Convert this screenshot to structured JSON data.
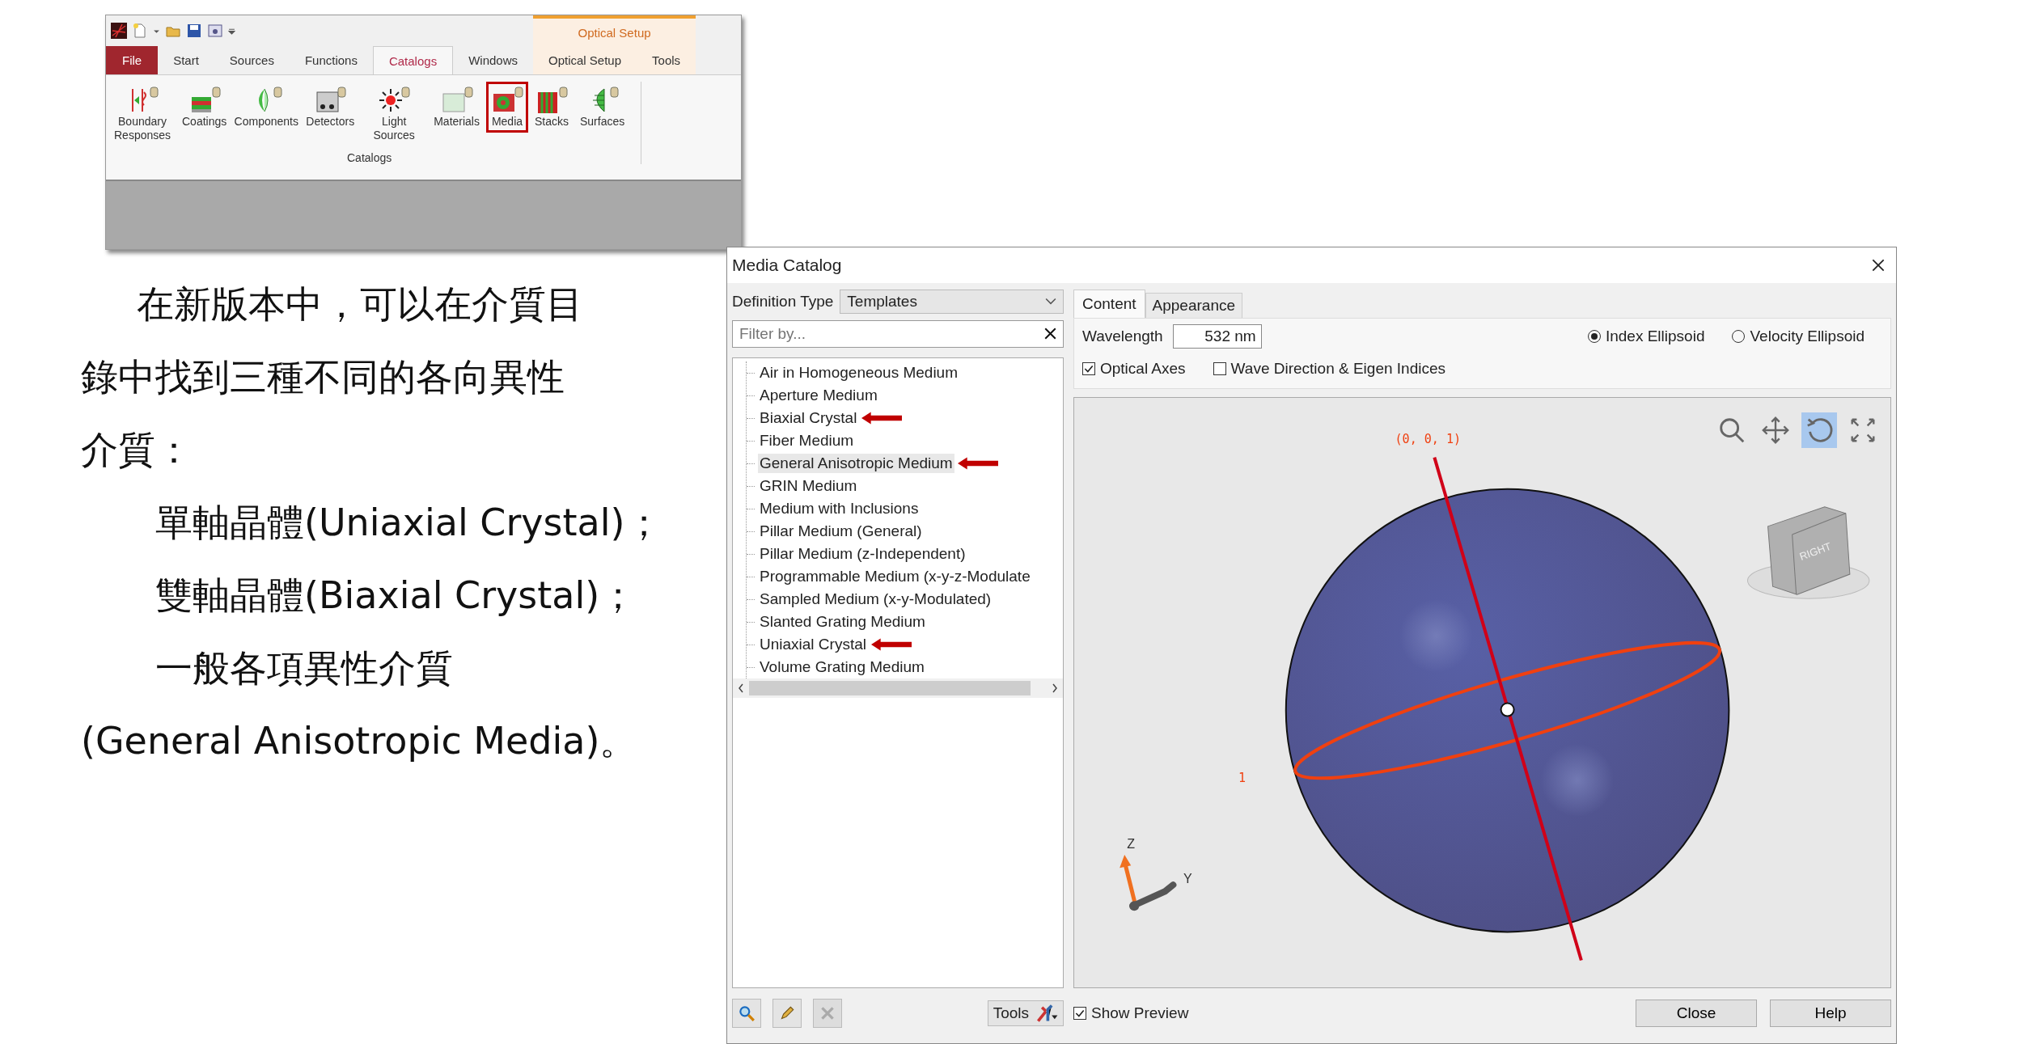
{
  "ribbon": {
    "tabs": [
      {
        "label": "File",
        "kind": "file",
        "selected": false,
        "contextual": false
      },
      {
        "label": "Start",
        "kind": "tab",
        "selected": false,
        "contextual": false
      },
      {
        "label": "Sources",
        "kind": "tab",
        "selected": false,
        "contextual": false
      },
      {
        "label": "Functions",
        "kind": "tab",
        "selected": false,
        "contextual": false
      },
      {
        "label": "Catalogs",
        "kind": "tab",
        "selected": true,
        "contextual": false
      },
      {
        "label": "Windows",
        "kind": "tab",
        "selected": false,
        "contextual": false
      },
      {
        "label": "Optical Setup",
        "kind": "tab",
        "selected": false,
        "contextual": true
      },
      {
        "label": "Tools",
        "kind": "tab",
        "selected": false,
        "contextual": true
      }
    ],
    "contextual_group": "Optical Setup",
    "buttons": [
      {
        "label": "Boundary Responses",
        "highlighted": false
      },
      {
        "label": "Coatings",
        "highlighted": false
      },
      {
        "label": "Components",
        "highlighted": false
      },
      {
        "label": "Detectors",
        "highlighted": false
      },
      {
        "label": "Light Sources",
        "highlighted": false
      },
      {
        "label": "Materials",
        "highlighted": false
      },
      {
        "label": "Media",
        "highlighted": true
      },
      {
        "label": "Stacks",
        "highlighted": false
      },
      {
        "label": "Surfaces",
        "highlighted": false
      }
    ],
    "group_label": "Catalogs"
  },
  "text": {
    "intro": "在新版本中，可以在介質目錄中找到三種不同的各向異性介質：",
    "items": [
      "單軸晶體(Uniaxial Crystal)；",
      "雙軸晶體(Biaxial Crystal)；",
      "一般各項異性介質\n(General Anisotropic Media)。"
    ]
  },
  "dialog": {
    "title": "Media Catalog",
    "definition_type": {
      "label": "Definition Type",
      "value": "Templates"
    },
    "filter": {
      "placeholder": "Filter by..."
    },
    "tree": [
      {
        "label": "Air in Homogeneous Medium",
        "selected": false,
        "marked": false
      },
      {
        "label": "Aperture Medium",
        "selected": false,
        "marked": false
      },
      {
        "label": "Biaxial Crystal",
        "selected": false,
        "marked": true
      },
      {
        "label": "Fiber Medium",
        "selected": false,
        "marked": false
      },
      {
        "label": "General Anisotropic Medium",
        "selected": true,
        "marked": true
      },
      {
        "label": "GRIN Medium",
        "selected": false,
        "marked": false
      },
      {
        "label": "Medium with Inclusions",
        "selected": false,
        "marked": false
      },
      {
        "label": "Pillar Medium (General)",
        "selected": false,
        "marked": false
      },
      {
        "label": "Pillar Medium (z-Independent)",
        "selected": false,
        "marked": false
      },
      {
        "label": "Programmable Medium (x-y-z-Modulate",
        "selected": false,
        "marked": false
      },
      {
        "label": "Sampled Medium (x-y-Modulated)",
        "selected": false,
        "marked": false
      },
      {
        "label": "Slanted Grating Medium",
        "selected": false,
        "marked": false
      },
      {
        "label": "Uniaxial Crystal",
        "selected": false,
        "marked": true
      },
      {
        "label": "Volume Grating Medium",
        "selected": false,
        "marked": false
      }
    ],
    "tools_button": "Tools",
    "tabs": [
      {
        "label": "Content",
        "selected": true
      },
      {
        "label": "Appearance",
        "selected": false
      }
    ],
    "wavelength": {
      "label": "Wavelength",
      "value": "532 nm"
    },
    "radios": [
      {
        "label": "Index Ellipsoid",
        "selected": true
      },
      {
        "label": "Velocity Ellipsoid",
        "selected": false
      }
    ],
    "checkboxes": [
      {
        "label": "Optical Axes",
        "checked": true
      },
      {
        "label": "Wave Direction & Eigen Indices",
        "checked": false
      }
    ],
    "preview": {
      "axis_label": "(0, 0, 1)",
      "radius_label": "1",
      "cube_label": "RIGHT",
      "triad_labels": [
        "Z",
        "Y"
      ],
      "view_tools": [
        {
          "selected": false
        },
        {
          "selected": false
        },
        {
          "selected": true
        },
        {
          "selected": false
        }
      ]
    },
    "show_preview": {
      "label": "Show Preview",
      "checked": true
    },
    "buttons": [
      "Close",
      "Help"
    ]
  }
}
